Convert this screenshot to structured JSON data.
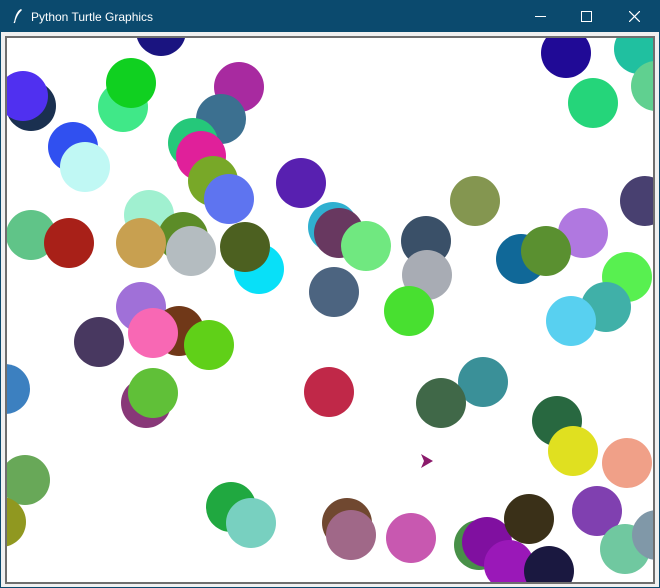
{
  "window": {
    "title": "Python Turtle Graphics",
    "titlebar_color": "#0b4a6e",
    "controls": [
      "minimize-icon",
      "maximize-icon",
      "close-icon"
    ]
  },
  "canvas": {
    "background": "#ffffff",
    "turtle": {
      "color": "#8b1a6b",
      "shape": "arrow"
    }
  }
}
